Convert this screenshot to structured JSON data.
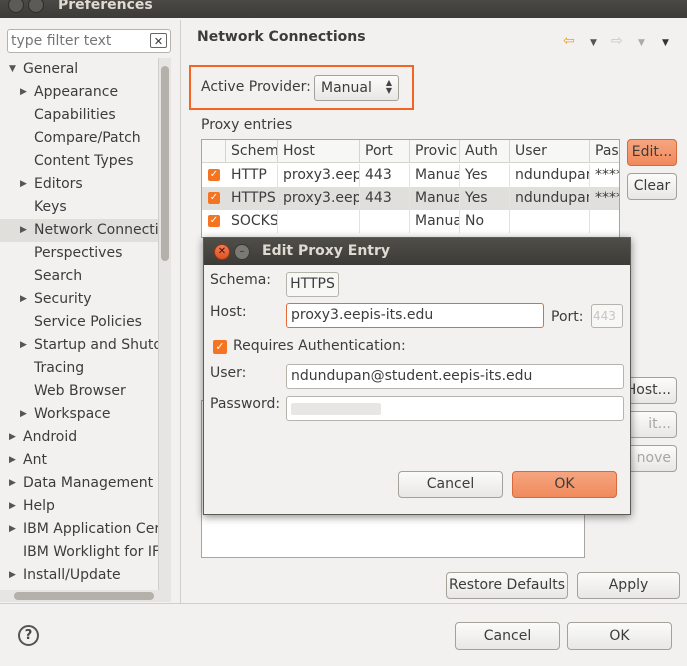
{
  "window": {
    "title": "Preferences"
  },
  "filter": {
    "placeholder": "type filter text"
  },
  "tree": [
    {
      "label": "General",
      "level": 0,
      "arrow": "▼"
    },
    {
      "label": "Appearance",
      "level": 1,
      "arrow": "▶"
    },
    {
      "label": "Capabilities",
      "level": 1,
      "arrow": ""
    },
    {
      "label": "Compare/Patch",
      "level": 1,
      "arrow": ""
    },
    {
      "label": "Content Types",
      "level": 1,
      "arrow": ""
    },
    {
      "label": "Editors",
      "level": 1,
      "arrow": "▶"
    },
    {
      "label": "Keys",
      "level": 1,
      "arrow": ""
    },
    {
      "label": "Network Connecti",
      "level": 1,
      "arrow": "▶",
      "selected": true
    },
    {
      "label": "Perspectives",
      "level": 1,
      "arrow": ""
    },
    {
      "label": "Search",
      "level": 1,
      "arrow": ""
    },
    {
      "label": "Security",
      "level": 1,
      "arrow": "▶"
    },
    {
      "label": "Service Policies",
      "level": 1,
      "arrow": ""
    },
    {
      "label": "Startup and Shutd",
      "level": 1,
      "arrow": "▶"
    },
    {
      "label": "Tracing",
      "level": 1,
      "arrow": ""
    },
    {
      "label": "Web Browser",
      "level": 1,
      "arrow": ""
    },
    {
      "label": "Workspace",
      "level": 1,
      "arrow": "▶"
    },
    {
      "label": "Android",
      "level": 0,
      "arrow": "▶"
    },
    {
      "label": "Ant",
      "level": 0,
      "arrow": "▶"
    },
    {
      "label": "Data Management",
      "level": 0,
      "arrow": "▶"
    },
    {
      "label": "Help",
      "level": 0,
      "arrow": "▶"
    },
    {
      "label": "IBM Application Cer",
      "level": 0,
      "arrow": "▶"
    },
    {
      "label": "IBM Worklight for IF",
      "level": 0,
      "arrow": ""
    },
    {
      "label": "Install/Update",
      "level": 0,
      "arrow": "▶"
    }
  ],
  "page": {
    "title": "Network Connections",
    "active_provider_label": "Active Provider:",
    "active_provider_value": "Manual",
    "proxy_entries_label": "Proxy entries"
  },
  "proxy_table": {
    "columns": [
      "Schem",
      "Host",
      "Port",
      "Provic",
      "Auth",
      "User",
      "Pass"
    ],
    "rows": [
      {
        "schema": "HTTP",
        "host": "proxy3.eep",
        "port": "443",
        "provider": "Manua",
        "auth": "Yes",
        "user": "ndundupan",
        "pass": "****"
      },
      {
        "schema": "HTTPS",
        "host": "proxy3.eep",
        "port": "443",
        "provider": "Manua",
        "auth": "Yes",
        "user": "ndundupan",
        "pass": "****"
      },
      {
        "schema": "SOCKS",
        "host": "",
        "port": "",
        "provider": "Manua",
        "auth": "No",
        "user": "",
        "pass": ""
      }
    ]
  },
  "buttons": {
    "edit": "Edit...",
    "clear": "Clear",
    "add_host": "Host...",
    "edit_host": "it...",
    "remove_host": "nove",
    "restore_defaults": "Restore Defaults",
    "apply": "Apply",
    "cancel": "Cancel",
    "ok": "OK"
  },
  "dialog": {
    "title": "Edit Proxy Entry",
    "schema_label": "Schema:",
    "schema_value": "HTTPS",
    "host_label": "Host:",
    "host_value": "proxy3.eepis-its.edu",
    "port_label": "Port:",
    "port_value": "443",
    "requires_auth_label": "Requires Authentication:",
    "requires_auth_checked": true,
    "user_label": "User:",
    "user_value": "ndundupan@student.eepis-its.edu",
    "password_label": "Password:",
    "cancel": "Cancel",
    "ok": "OK"
  },
  "colors": {
    "accent": "#f47421",
    "highlight_border": "#f26522"
  }
}
